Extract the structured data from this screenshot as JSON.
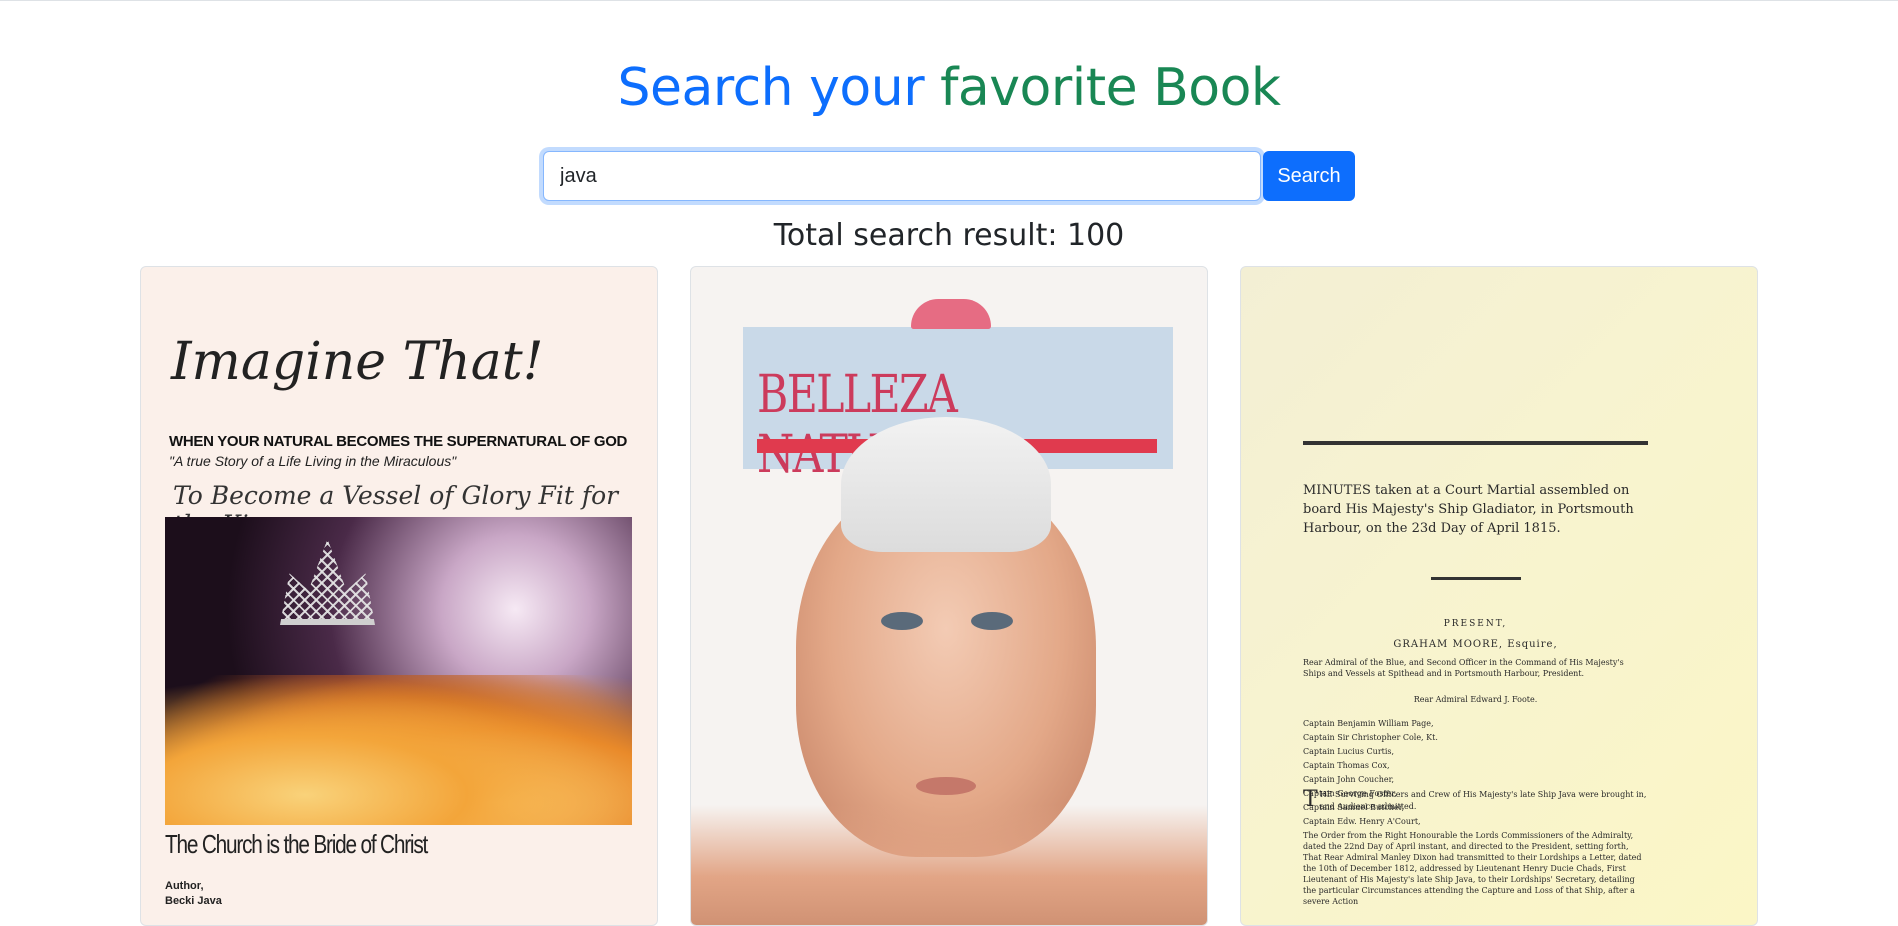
{
  "header": {
    "title_part1": "Search your",
    "title_part2": "favorite Book"
  },
  "search": {
    "value": "java",
    "button_label": "Search"
  },
  "results": {
    "label": "Total search result: 100"
  },
  "books": [
    {
      "title": "Imagine That!",
      "subtitle": "WHEN YOUR NATURAL BECOMES THE SUPERNATURAL OF GOD",
      "tagline": "\"A true Story of a Life Living in the Miraculous\"",
      "script_line": "To Become a Vessel of Glory Fit for the King",
      "bottom_title": "The Church is the Bride of Christ",
      "author_label": "Author,",
      "author_name": "Becki Java"
    },
    {
      "title": "BELLEZA NATURAL"
    },
    {
      "minutes": "MINUTES taken at a Court Martial assembled on board His Majesty's Ship Gladiator, in Portsmouth Harbour, on the 23d Day of April 1815.",
      "present": "PRESENT,",
      "president": "GRAHAM MOORE, Esquire,",
      "rear_admiral_line": "Rear Admiral of the Blue, and Second Officer in the Command of His Majesty's Ships and Vessels at Spithead and in Portsmouth Harbour, President.",
      "rear_admiral_2": "Rear Admiral Edward J. Foote.",
      "captains_left": [
        "Captain Benjamin William Page,",
        "Captain Sir Christopher Cole, Kt.",
        "Captain Lucius Curtis,",
        "Captain Thomas Cox,"
      ],
      "captains_right": [
        "Captain John Coucher,",
        "Captain George Foster,",
        "Captain Samuel Butcher,",
        "Captain Edw. Henry A'Court,"
      ],
      "surviving": "HE Surviving Officers and Crew of His Majesty's late Ship Java were brought in, and Audience admitted.",
      "order": "The Order from the Right Honourable the Lords Commissioners of the Admiralty, dated the 22nd Day of April instant, and directed to the President, setting forth, That Rear Admiral Manley Dixon had transmitted to their Lordships a Letter, dated the 10th of December 1812, addressed by Lieutenant Henry Ducie Chads, First Lieutenant of His Majesty's late Ship Java, to their Lordships' Secretary, detailing the particular Circumstances attending the Capture and Loss of that Ship, after a severe Action"
    }
  ],
  "colors": {
    "title_blue": "#0d6efd",
    "title_green": "#198754",
    "button": "#0d6efd"
  }
}
